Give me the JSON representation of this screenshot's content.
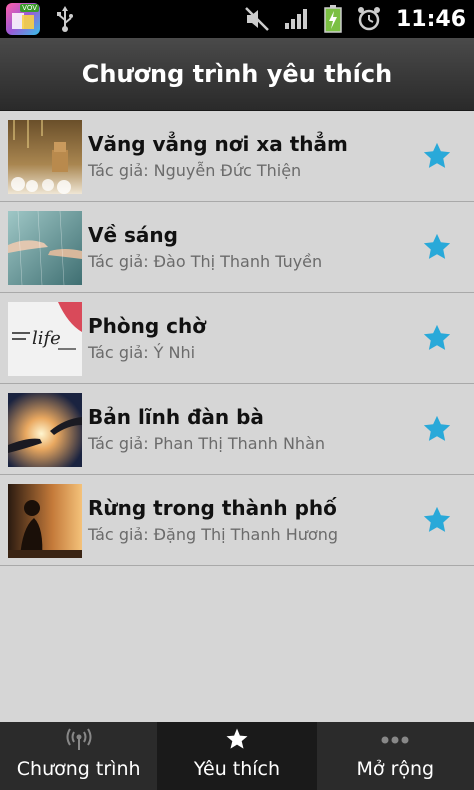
{
  "status_bar": {
    "time": "11:46",
    "app_badge": "VOV"
  },
  "header": {
    "title": "Chương trình yêu thích"
  },
  "favorites": [
    {
      "title": "Văng vẳng nơi xa thẳm",
      "author_prefix": "Tác giả:",
      "author": "Nguyễn Đức Thiện",
      "thumbnail": "snow-bokeh-figurine-photo"
    },
    {
      "title": "Về sáng",
      "author_prefix": "Tác giả:",
      "author": "Đào Thị Thanh Tuyền",
      "thumbnail": "hands-in-rain-photo"
    },
    {
      "title": "Phòng chờ",
      "author_prefix": "Tác giả:",
      "author": "Ý Nhi",
      "thumbnail": "life-text-photo"
    },
    {
      "title": "Bản lĩnh đàn bà",
      "author_prefix": "Tác giả:",
      "author": "Phan Thị Thanh Nhàn",
      "thumbnail": "hands-reaching-light-photo"
    },
    {
      "title": "Rừng trong thành phố",
      "author_prefix": "Tác giả:",
      "author": "Đặng Thị Thanh Hương",
      "thumbnail": "woman-sunset-silhouette-photo"
    }
  ],
  "bottom_nav": [
    {
      "label": "Chương trình",
      "icon": "broadcast-icon",
      "active": false
    },
    {
      "label": "Yêu thích",
      "icon": "star-icon",
      "active": true
    },
    {
      "label": "Mở rộng",
      "icon": "more-dots-icon",
      "active": false
    }
  ],
  "colors": {
    "star": "#29a9d9",
    "list_bg": "#d6d6d6",
    "header_bg": "#3a3a3a"
  }
}
